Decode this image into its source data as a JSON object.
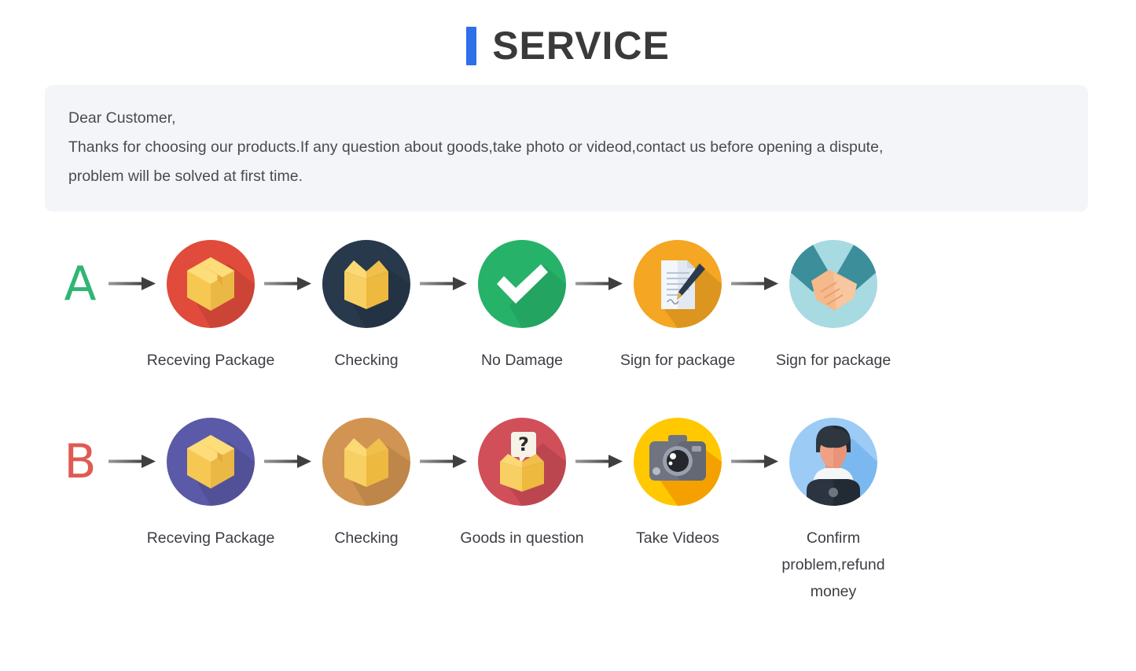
{
  "header": {
    "accent_color": "#2f6fe8",
    "title": "SERVICE"
  },
  "notice": {
    "background_color": "#f4f5f9",
    "line1": "Dear Customer,",
    "line2": "Thanks for choosing our products.If any question about goods,take photo or videod,contact us before opening a dispute,",
    "line3": "problem will be solved at first time."
  },
  "flows": [
    {
      "badge": {
        "label": "A",
        "color": "#2fb673"
      },
      "steps": [
        {
          "icon": "package-closed-icon",
          "circle_color": "#e04b3c",
          "label": "Receving Package"
        },
        {
          "icon": "package-open-icon",
          "circle_color": "#27394b",
          "label": "Checking"
        },
        {
          "icon": "checkmark-icon",
          "circle_color": "#26b269",
          "label": "No Damage"
        },
        {
          "icon": "document-sign-icon",
          "circle_color": "#f5a623",
          "label": "Sign for package"
        },
        {
          "icon": "handshake-icon",
          "circle_color": "#a8dae2",
          "label": "Sign for package"
        }
      ]
    },
    {
      "badge": {
        "label": "B",
        "color": "#e05a52"
      },
      "steps": [
        {
          "icon": "package-closed-icon",
          "circle_color": "#5b5aa8",
          "label": "Receving Package"
        },
        {
          "icon": "package-open-icon",
          "circle_color": "#d29452",
          "label": "Checking"
        },
        {
          "icon": "package-question-icon",
          "circle_color": "#d14f58",
          "label": "Goods in question"
        },
        {
          "icon": "camera-icon",
          "circle_color": "#ffc800",
          "label": "Take Videos"
        },
        {
          "icon": "person-support-icon",
          "circle_color": "#9ccbf5",
          "label": "Confirm problem,refund money"
        }
      ]
    }
  ],
  "arrow": {
    "icon": "arrow-right-icon",
    "color": "#4a4a4a"
  }
}
